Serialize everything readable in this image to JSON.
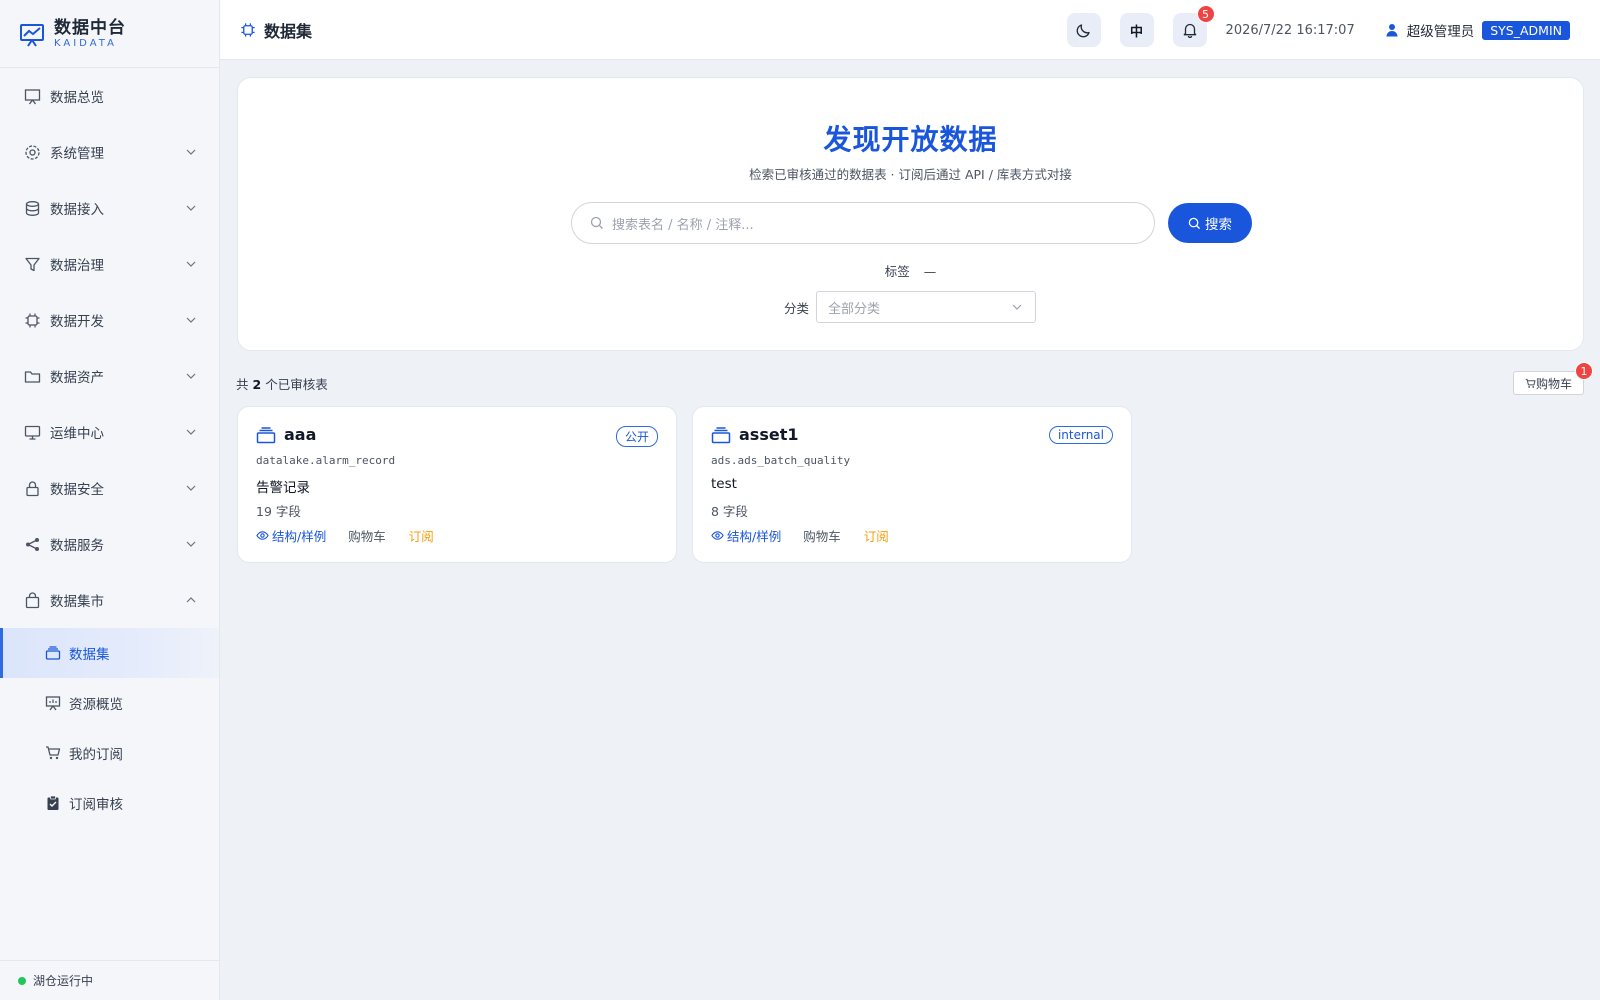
{
  "app": {
    "title": "数据中台",
    "subtitle": "KAIDATA"
  },
  "sidebar": {
    "items": [
      {
        "label": "数据总览",
        "icon": "presentation-icon",
        "expandable": false
      },
      {
        "label": "系统管理",
        "icon": "gear-icon",
        "expandable": true
      },
      {
        "label": "数据接入",
        "icon": "database-icon",
        "expandable": true
      },
      {
        "label": "数据治理",
        "icon": "filter-icon",
        "expandable": true
      },
      {
        "label": "数据开发",
        "icon": "chip-icon",
        "expandable": true
      },
      {
        "label": "数据资产",
        "icon": "folder-icon",
        "expandable": true
      },
      {
        "label": "运维中心",
        "icon": "monitor-icon",
        "expandable": true
      },
      {
        "label": "数据安全",
        "icon": "lock-icon",
        "expandable": true
      },
      {
        "label": "数据服务",
        "icon": "share-icon",
        "expandable": true
      },
      {
        "label": "数据集市",
        "icon": "shopping-bag-icon",
        "expandable": true,
        "expanded": true
      }
    ],
    "subitems": [
      {
        "label": "数据集",
        "icon": "layers-icon",
        "active": true
      },
      {
        "label": "资源概览",
        "icon": "presentation-icon",
        "active": false
      },
      {
        "label": "我的订阅",
        "icon": "cart-icon",
        "active": false
      },
      {
        "label": "订阅审核",
        "icon": "clipboard-check-icon",
        "active": false
      }
    ],
    "footer_status": "湖仓运行中"
  },
  "header": {
    "title": "数据集",
    "lang_label": "中",
    "notifications": "5",
    "datetime": "2026/7/22 16:17:07",
    "user_name": "超级管理员",
    "role": "SYS_ADMIN"
  },
  "hero": {
    "title": "发现开放数据",
    "subtitle": "检索已审核通过的数据表 · 订阅后通过 API / 库表方式对接",
    "search_placeholder": "搜索表名 / 名称 / 注释...",
    "search_button": "搜索",
    "tags_label": "标签",
    "tags_value": "—",
    "category_label": "分类",
    "category_placeholder": "全部分类"
  },
  "results": {
    "count_prefix": "共",
    "count": "2",
    "count_suffix": "个已审核表",
    "cart_label": "购物车",
    "cart_count": "1"
  },
  "cards": [
    {
      "name": "aaa",
      "tag": "公开",
      "path": "datalake.alarm_record",
      "desc": "告警记录",
      "fields": "19 字段",
      "schema_label": "结构/样例",
      "cart_label": "购物车",
      "subscribe_label": "订阅"
    },
    {
      "name": "asset1",
      "tag": "internal",
      "path": "ads.ads_batch_quality",
      "desc": "test",
      "fields": "8 字段",
      "schema_label": "结构/样例",
      "cart_label": "购物车",
      "subscribe_label": "订阅"
    }
  ],
  "colors": {
    "primary": "#1a56db",
    "badge": "#ef4444",
    "subscribe": "#f59e0b",
    "status_ok": "#22c55e"
  }
}
